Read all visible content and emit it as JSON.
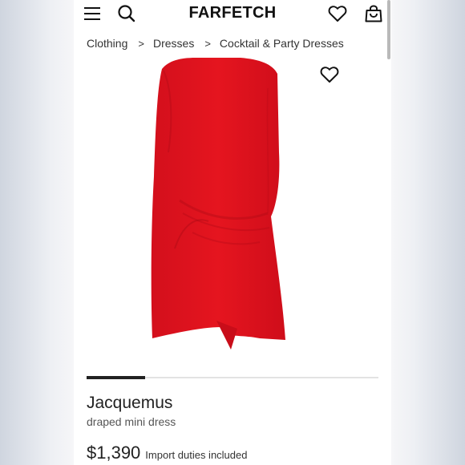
{
  "header": {
    "brand": "FARFETCH",
    "icons": [
      "menu-icon",
      "search-icon",
      "heart-icon",
      "shopping-bag-icon"
    ]
  },
  "breadcrumb": {
    "items": [
      "Clothing",
      "Dresses",
      "Cocktail & Party Dresses"
    ],
    "separator": ">"
  },
  "product": {
    "designer": "Jacquemus",
    "name": "draped mini dress",
    "price": "$1,390",
    "duties_note": "Import duties included",
    "image_color": "#e1121f",
    "gallery_position": 0.2
  },
  "colors": {
    "text": "#222222",
    "dress_red": "#e1121f"
  }
}
